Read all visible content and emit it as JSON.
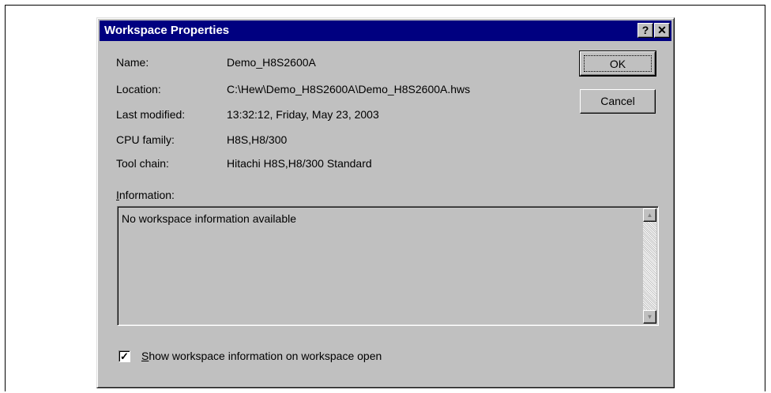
{
  "dialog": {
    "title": "Workspace Properties",
    "help_glyph": "?",
    "close_glyph": "✕"
  },
  "props": {
    "name_label": "Name:",
    "name_value": "Demo_H8S2600A",
    "location_label": "Location:",
    "location_value": "C:\\Hew\\Demo_H8S2600A\\Demo_H8S2600A.hws",
    "modified_label": "Last modified:",
    "modified_value": "13:32:12, Friday, May 23, 2003",
    "cpu_label": "CPU family:",
    "cpu_value": "H8S,H8/300",
    "toolchain_label": "Tool chain:",
    "toolchain_value": "Hitachi H8S,H8/300 Standard"
  },
  "buttons": {
    "ok": "OK",
    "cancel": "Cancel"
  },
  "info": {
    "label_first": "I",
    "label_rest": "nformation:",
    "text": "No workspace information available"
  },
  "option": {
    "label_first": "S",
    "label_rest": "how workspace information on workspace open",
    "checked": true,
    "check_glyph": "✓"
  },
  "scrollbar": {
    "up_glyph": "▲",
    "down_glyph": "▼"
  }
}
